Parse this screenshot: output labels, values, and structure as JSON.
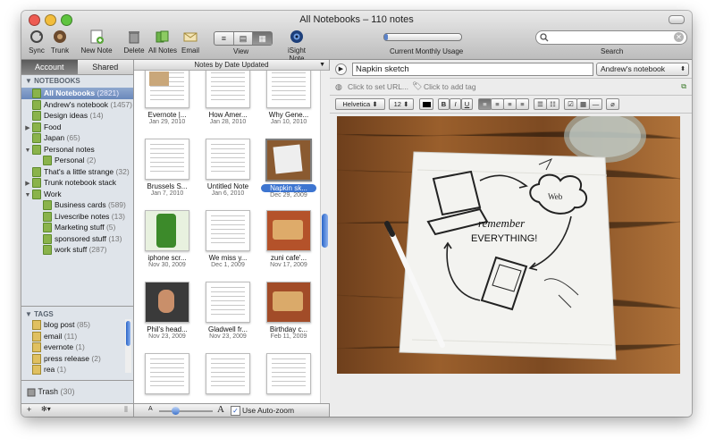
{
  "window": {
    "title": "All Notebooks – 110 notes"
  },
  "toolbar": {
    "sync": "Sync",
    "trunk": "Trunk",
    "new_note": "New Note",
    "delete": "Delete",
    "all_notes": "All Notes",
    "email": "Email",
    "view": "View",
    "isight": "iSight Note",
    "usage_label": "Current Monthly Usage",
    "usage_fraction": 0.05,
    "search_label": "Search"
  },
  "sidebar": {
    "tabs": [
      "Account",
      "Shared"
    ],
    "notebooks_header": "NOTEBOOKS",
    "notebooks": [
      {
        "name": "All Notebooks",
        "count": "(2821)",
        "indent": 0,
        "expander": "",
        "selected": true
      },
      {
        "name": "Andrew's notebook",
        "count": "(1457)",
        "indent": 0,
        "expander": "",
        "selected": false
      },
      {
        "name": "Design ideas",
        "count": "(14)",
        "indent": 0,
        "expander": "",
        "selected": false
      },
      {
        "name": "Food",
        "count": "",
        "indent": 0,
        "expander": "▶",
        "selected": false
      },
      {
        "name": "Japan",
        "count": "(65)",
        "indent": 0,
        "expander": "",
        "selected": false
      },
      {
        "name": "Personal notes",
        "count": "",
        "indent": 0,
        "expander": "▼",
        "selected": false
      },
      {
        "name": "Personal",
        "count": "(2)",
        "indent": 1,
        "expander": "",
        "selected": false
      },
      {
        "name": "That's a little strange",
        "count": "(32)",
        "indent": 0,
        "expander": "",
        "selected": false
      },
      {
        "name": "Trunk notebook stack",
        "count": "",
        "indent": 0,
        "expander": "▶",
        "selected": false
      },
      {
        "name": "Work",
        "count": "",
        "indent": 0,
        "expander": "▼",
        "selected": false
      },
      {
        "name": "Business cards",
        "count": "(589)",
        "indent": 1,
        "expander": "",
        "selected": false
      },
      {
        "name": "Livescribe notes",
        "count": "(13)",
        "indent": 1,
        "expander": "",
        "selected": false
      },
      {
        "name": "Marketing stuff",
        "count": "(5)",
        "indent": 1,
        "expander": "",
        "selected": false
      },
      {
        "name": "sponsored stuff",
        "count": "(13)",
        "indent": 1,
        "expander": "",
        "selected": false
      },
      {
        "name": "work stuff",
        "count": "(287)",
        "indent": 1,
        "expander": "",
        "selected": false
      }
    ],
    "tags_header": "TAGS",
    "tags": [
      {
        "name": "blog post",
        "count": "(85)"
      },
      {
        "name": "email",
        "count": "(11)"
      },
      {
        "name": "evernote",
        "count": "(1)"
      },
      {
        "name": "press release",
        "count": "(2)"
      },
      {
        "name": "rea",
        "count": "(1)"
      }
    ],
    "trash": "Trash",
    "trash_count": "(30)"
  },
  "notes_list": {
    "header": "Notes by Date Updated",
    "notes": [
      {
        "title": "Evernote |...",
        "date": "Jan 29, 2010",
        "selected": false,
        "thumb": "doc-image"
      },
      {
        "title": "How Amer...",
        "date": "Jan 28, 2010",
        "selected": false,
        "thumb": "doc"
      },
      {
        "title": "Why Gene...",
        "date": "Jan 10, 2010",
        "selected": false,
        "thumb": "doc"
      },
      {
        "title": "Brussels S...",
        "date": "Jan 7, 2010",
        "selected": false,
        "thumb": "doc"
      },
      {
        "title": "Untitled Note",
        "date": "Jan 6, 2010",
        "selected": false,
        "thumb": "doc"
      },
      {
        "title": "Napkin sk...",
        "date": "Dec 29, 2009",
        "selected": true,
        "thumb": "napkin"
      },
      {
        "title": "iphone scr...",
        "date": "Nov 30, 2009",
        "selected": false,
        "thumb": "phone"
      },
      {
        "title": "We miss y...",
        "date": "Dec 1, 2009",
        "selected": false,
        "thumb": "doc"
      },
      {
        "title": "zuni cafe'...",
        "date": "Nov 17, 2009",
        "selected": false,
        "thumb": "food"
      },
      {
        "title": "Phil's head...",
        "date": "Nov 23, 2009",
        "selected": false,
        "thumb": "portrait"
      },
      {
        "title": "Gladwell fr...",
        "date": "Nov 23, 2009",
        "selected": false,
        "thumb": "doc"
      },
      {
        "title": "Birthday c...",
        "date": "Feb 11, 2009",
        "selected": false,
        "thumb": "cake"
      },
      {
        "title": "",
        "date": "",
        "selected": false,
        "thumb": "doc"
      },
      {
        "title": "",
        "date": "",
        "selected": false,
        "thumb": "doc"
      },
      {
        "title": "",
        "date": "",
        "selected": false,
        "thumb": "doc"
      }
    ],
    "autozoom_label": "Use Auto-zoom",
    "autozoom_checked": true
  },
  "note": {
    "title": "Napkin sketch",
    "notebook": "Andrew's notebook",
    "url_placeholder": "Click to set URL...",
    "tag_placeholder": "Click to add tag",
    "font": "Helvetica",
    "size": "12",
    "sketch_text": [
      "remember",
      "EVERYTHING!",
      "Web"
    ]
  }
}
